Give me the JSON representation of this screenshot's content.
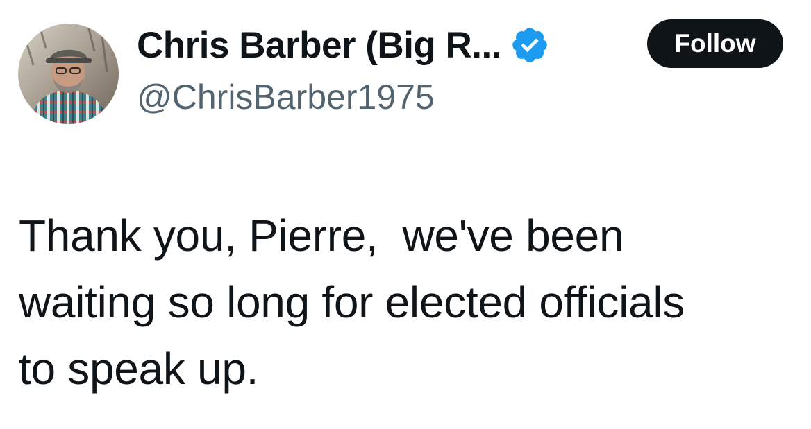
{
  "author": {
    "display_name": "Chris Barber (Big R...",
    "handle": "@ChrisBarber1975",
    "verified": true,
    "avatar_icon": "profile-photo-avatar"
  },
  "actions": {
    "follow_label": "Follow"
  },
  "tweet": {
    "text": "Thank you, Pierre,  we've been\nwaiting so long for elected officials\nto speak up."
  },
  "colors": {
    "verified_blue": "#1d9bf0",
    "follow_bg": "#0f1419",
    "handle_gray": "#536471"
  }
}
